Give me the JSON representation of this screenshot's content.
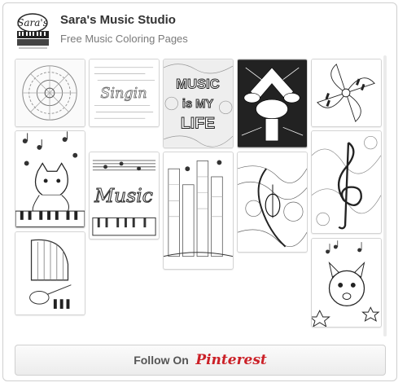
{
  "header": {
    "title": "Sara's Music Studio",
    "subtitle": "Free Music Coloring Pages",
    "logo_text": "Sara's MUSIC STUDIO PIANO & GUITAR"
  },
  "pins": [
    {
      "label": "mandala music coloring page"
    },
    {
      "label": "singing lyrics coloring page"
    },
    {
      "label": "music is my life coloring page"
    },
    {
      "label": "drum kit coloring page"
    },
    {
      "label": "piano keys swirl coloring page"
    },
    {
      "label": "cat on piano coloring page"
    },
    {
      "label": "music word coloring page"
    },
    {
      "label": "music notes city coloring page"
    },
    {
      "label": "violin doodle coloring page"
    },
    {
      "label": "treble clef coloring page"
    },
    {
      "label": "harp and instruments coloring page"
    },
    {
      "label": "singing character coloring page"
    }
  ],
  "footer": {
    "follow_label": "Follow On",
    "brand": "Pinterest"
  },
  "colors": {
    "brand_red": "#cb2027",
    "border": "#cfcfcf"
  }
}
